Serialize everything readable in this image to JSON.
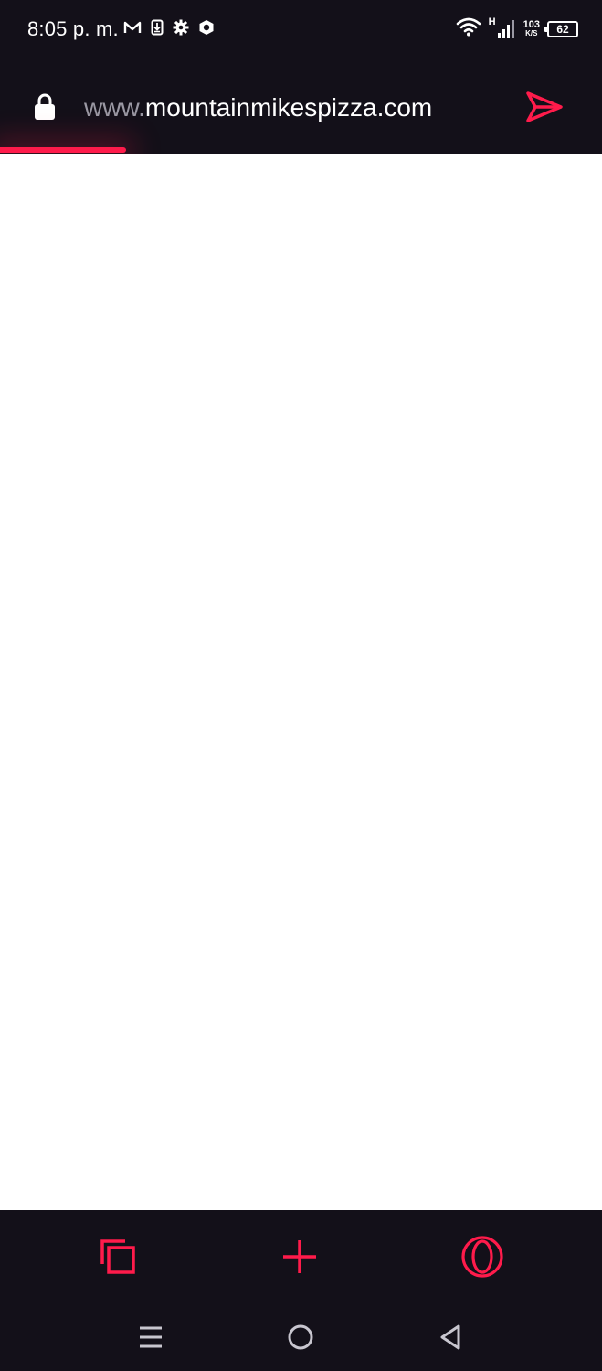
{
  "status_bar": {
    "time": "8:05 p. m.",
    "left_icons": [
      "gmail-icon",
      "download-icon",
      "settings-icon",
      "shield-icon"
    ],
    "network_type": "H",
    "net_speed_value": "103",
    "net_speed_unit": "K/S",
    "battery_level": "62"
  },
  "browser": {
    "url_prefix": "www.",
    "url_domain": "mountainmikespizza.com",
    "load_progress": 0.21,
    "accent_color": "#ff1b4b"
  },
  "toolbar": {
    "buttons": [
      "tabs-icon",
      "new-tab-icon",
      "opera-menu-icon"
    ]
  },
  "navigation": {
    "buttons": [
      "recent-apps-icon",
      "home-icon",
      "back-icon"
    ]
  }
}
